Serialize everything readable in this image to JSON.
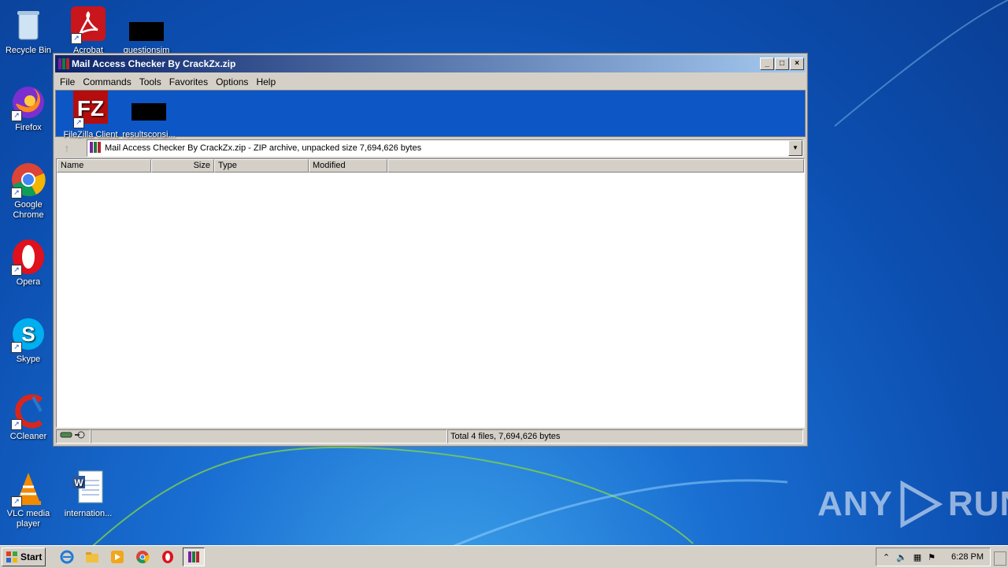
{
  "desktop": {
    "icons": [
      {
        "label": "Recycle Bin"
      },
      {
        "label": "Acrobat"
      },
      {
        "label": "questionsim"
      },
      {
        "label": "Firefox"
      },
      {
        "label": "FileZilla Client"
      },
      {
        "label": "resultsconsi..."
      },
      {
        "label": "Google Chrome"
      },
      {
        "label": "Opera"
      },
      {
        "label": "Skype"
      },
      {
        "label": "CCleaner"
      },
      {
        "label": "VLC media player"
      },
      {
        "label": "internation..."
      }
    ]
  },
  "window": {
    "title": "Mail Access Checker By CrackZx.zip",
    "menu": [
      "File",
      "Commands",
      "Tools",
      "Favorites",
      "Options",
      "Help"
    ],
    "address": "Mail Access Checker By CrackZx.zip - ZIP archive, unpacked size 7,694,626 bytes",
    "columns": [
      "Name",
      "Size",
      "Type",
      "Modified"
    ],
    "status_total": "Total 4 files, 7,694,626 bytes"
  },
  "taskbar": {
    "start_label": "Start",
    "clock": "6:28 PM"
  },
  "watermark": {
    "left": "ANY",
    "right": "RUN"
  },
  "colors": {
    "titlebar_start": "#0a246a",
    "titlebar_end": "#a6caf0",
    "desktop": "#1a6fd2",
    "toolbar": "#0c56c6"
  }
}
